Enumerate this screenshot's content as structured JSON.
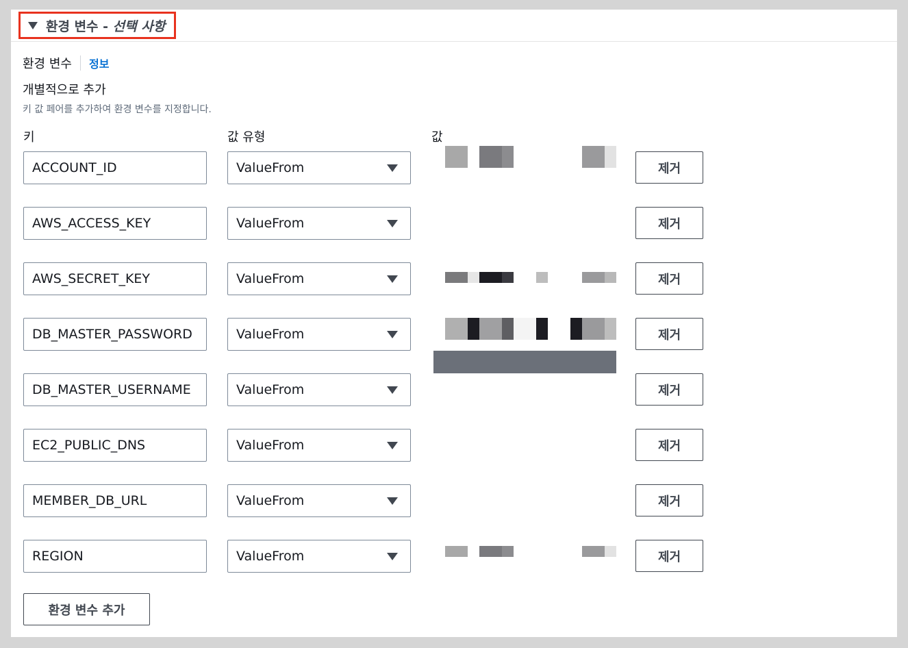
{
  "section": {
    "title_main": "환경 변수",
    "title_sep": " - ",
    "title_optional": "선택 사항"
  },
  "field": {
    "label": "환경 변수",
    "info_link": "정보",
    "subtitle": "개별적으로 추가",
    "description": "키 값 페어를 추가하여 환경 변수를 지정합니다."
  },
  "columns": {
    "key": "키",
    "value_type": "값 유형",
    "value": "값"
  },
  "rows": [
    {
      "key": "ACCOUNT_ID",
      "value_type": "ValueFrom",
      "remove_label": "제거"
    },
    {
      "key": "AWS_ACCESS_KEY",
      "value_type": "ValueFrom",
      "remove_label": "제거"
    },
    {
      "key": "AWS_SECRET_KEY",
      "value_type": "ValueFrom",
      "remove_label": "제거"
    },
    {
      "key": "DB_MASTER_PASSWORD",
      "value_type": "ValueFrom",
      "remove_label": "제거"
    },
    {
      "key": "DB_MASTER_USERNAME",
      "value_type": "ValueFrom",
      "remove_label": "제거"
    },
    {
      "key": "EC2_PUBLIC_DNS",
      "value_type": "ValueFrom",
      "remove_label": "제거"
    },
    {
      "key": "MEMBER_DB_URL",
      "value_type": "ValueFrom",
      "remove_label": "제거"
    },
    {
      "key": "REGION",
      "value_type": "ValueFrom",
      "remove_label": "제거"
    }
  ],
  "add_button_label": "환경 변수 추가",
  "colors": {
    "highlight": "#e8321e",
    "link": "#0972d3",
    "text": "#16191f",
    "muted": "#5f6b7a"
  }
}
